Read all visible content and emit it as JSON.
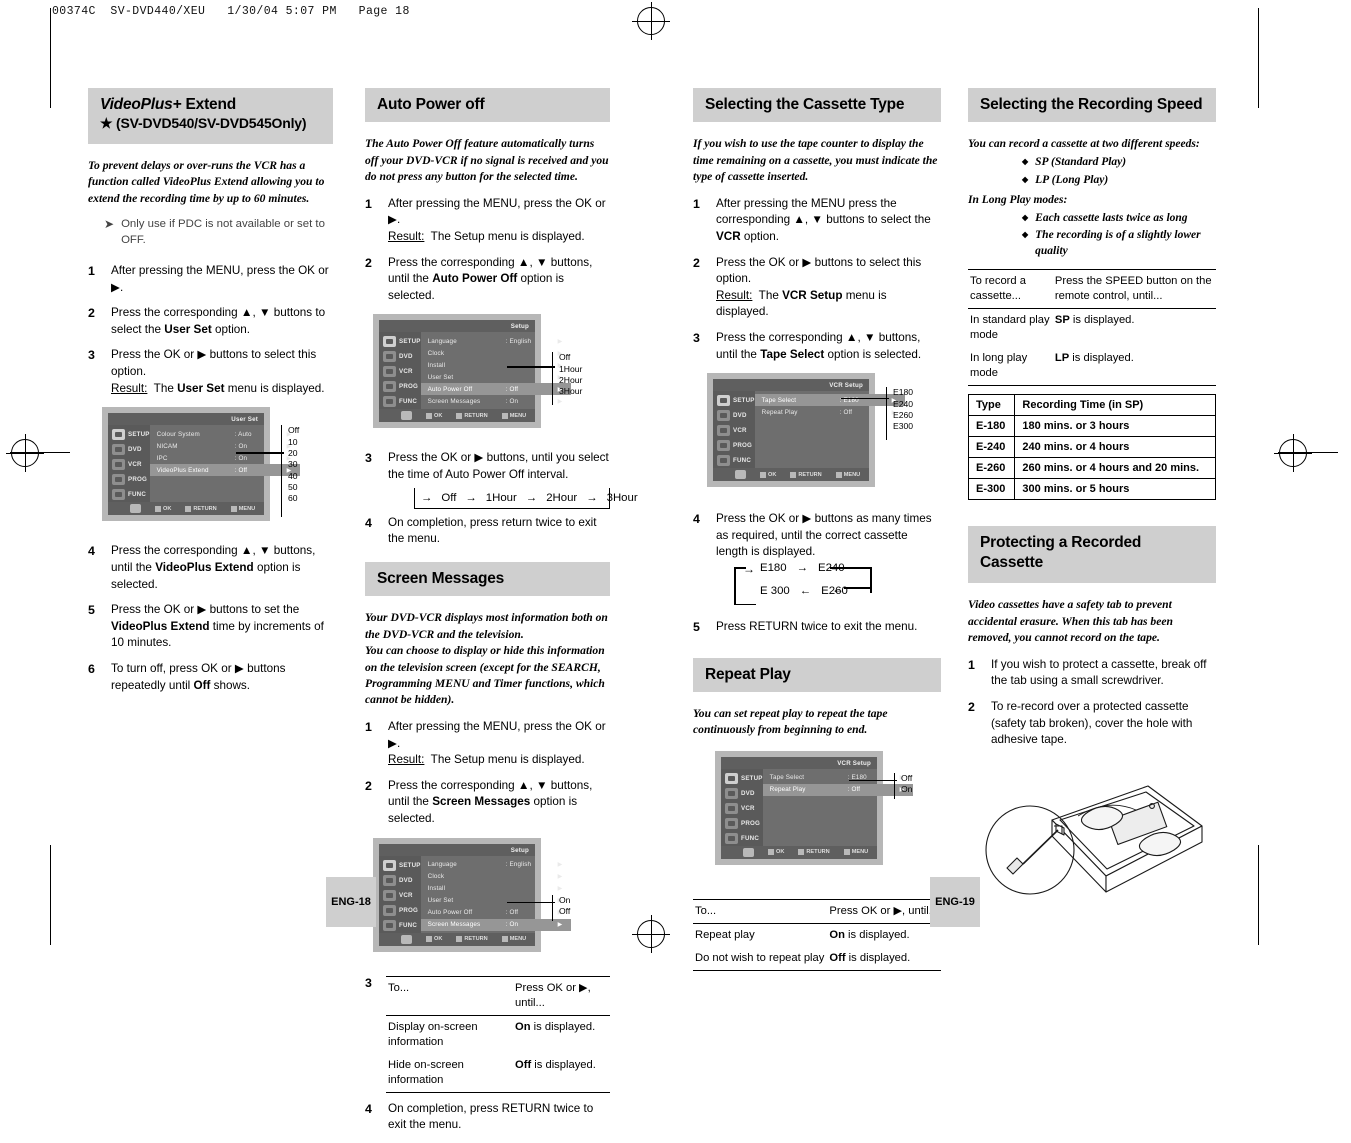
{
  "scan_header": "00374C  SV-DVD440/XEU   1/30/04 5:07 PM   Page 18",
  "page_badges": {
    "left": "ENG-18",
    "right": "ENG-19"
  },
  "osd_footer": {
    "ok": "OK",
    "return": "RETURN",
    "menu": "MENU"
  },
  "osd_sidebar": [
    "SETUP",
    "DVD",
    "VCR",
    "PROG",
    "FUNC"
  ],
  "col1": {
    "heading_line1_em": "VideoPlus+",
    "heading_line1_rest": " Extend",
    "heading_line2": "★ (SV-DVD540/SV-DVD545Only)",
    "intro": "To prevent delays or over-runs the VCR has a function called VideoPlus Extend allowing you to extend the recording time by up to 60 minutes.",
    "note": "Only use if PDC is not available or set to OFF.",
    "steps": [
      {
        "n": "1",
        "html": "After pressing the MENU, press the OK or ▶."
      },
      {
        "n": "2",
        "html": "Press the corresponding ▲, ▼ buttons to select the <b>User Set</b> option."
      },
      {
        "n": "3",
        "html": "Press the OK or ▶ buttons to select this option.<br><span class=\"u\">Result:</span>&nbsp; The <b>User Set</b> menu is displayed."
      }
    ],
    "osd": {
      "title": "User Set",
      "rows": [
        {
          "label": "Colour System",
          "value": ": Auto",
          "hl": false
        },
        {
          "label": "NICAM",
          "value": ": On",
          "hl": false
        },
        {
          "label": "IPC",
          "value": ": On",
          "hl": false
        },
        {
          "label": "VideoPlus Extend",
          "value": ": Off",
          "hl": true
        }
      ],
      "callout": [
        "Off",
        "10",
        "20",
        "30",
        "40",
        "50",
        "60"
      ]
    },
    "steps2": [
      {
        "n": "4",
        "html": "Press the corresponding ▲, ▼ buttons, until the <b>VideoPlus Extend</b> option is selected."
      },
      {
        "n": "5",
        "html": "Press the OK or ▶ buttons to set the <b>VideoPlus Extend</b> time by increments of 10 minutes."
      },
      {
        "n": "6",
        "html": "To turn off, press OK or ▶ buttons repeatedly until <b>Off</b> shows."
      }
    ]
  },
  "col2": {
    "heading1": "Auto Power off",
    "intro1": "The Auto Power Off feature automatically turns off your DVD-VCR if no signal is received and you do not press any button for the selected time.",
    "steps1": [
      {
        "n": "1",
        "html": "After pressing the MENU, press the OK or ▶.<br><span class=\"u\">Result:</span>&nbsp; The Setup menu is displayed."
      },
      {
        "n": "2",
        "html": "Press the corresponding ▲, ▼ buttons, until the <b>Auto Power Off</b> option is selected."
      }
    ],
    "osd1": {
      "title": "Setup",
      "rows": [
        {
          "label": "Language",
          "value": ": English",
          "hl": false
        },
        {
          "label": "Clock",
          "value": "",
          "hl": false
        },
        {
          "label": "Install",
          "value": "",
          "hl": false
        },
        {
          "label": "User Set",
          "value": "",
          "hl": false
        },
        {
          "label": "Auto Power Off",
          "value": ": Off",
          "hl": true
        },
        {
          "label": "Screen Messages",
          "value": ": On",
          "hl": false
        }
      ],
      "callout": [
        "Off",
        "1Hour",
        "2Hour",
        "3Hour"
      ]
    },
    "steps2": [
      {
        "n": "3",
        "html": "Press the OK or ▶ buttons, until you select the time of Auto Power Off interval."
      },
      {
        "n": "4",
        "html": "On completion, press return twice to exit the menu."
      }
    ],
    "cycle": [
      "Off",
      "1Hour",
      "2Hour",
      "3Hour"
    ],
    "heading2": "Screen Messages",
    "intro2": "Your DVD-VCR displays most information both on the DVD-VCR and the television.\nYou can choose to display or hide this information on the television screen (except for the SEARCH, Programming MENU and Timer functions, which cannot be hidden).",
    "steps3": [
      {
        "n": "1",
        "html": "After pressing the MENU, press the OK or ▶.<br><span class=\"u\">Result:</span>&nbsp; The Setup menu is displayed."
      },
      {
        "n": "2",
        "html": "Press the corresponding ▲, ▼ buttons, until the <b>Screen Messages</b> option is selected."
      }
    ],
    "osd2": {
      "title": "Setup",
      "rows": [
        {
          "label": "Language",
          "value": ": English",
          "hl": false
        },
        {
          "label": "Clock",
          "value": "",
          "hl": false
        },
        {
          "label": "Install",
          "value": "",
          "hl": false
        },
        {
          "label": "User Set",
          "value": "",
          "hl": false
        },
        {
          "label": "Auto Power Off",
          "value": ": Off",
          "hl": false
        },
        {
          "label": "Screen Messages",
          "value": ": On",
          "hl": true
        }
      ],
      "callout": [
        "On",
        "Off"
      ]
    },
    "table": {
      "step_n": "3",
      "head": [
        "To...",
        "Press OK or ▶, until..."
      ],
      "rows": [
        [
          "Display on-screen information",
          "On is displayed."
        ],
        [
          "Hide on-screen information",
          "Off is displayed."
        ]
      ]
    },
    "step4": {
      "n": "4",
      "html": "On completion, press RETURN twice to exit the menu."
    }
  },
  "col3": {
    "heading1": "Selecting the Cassette Type",
    "intro1": "If you wish to use the tape counter to display the time remaining on a cassette, you must indicate the type of cassette inserted.",
    "steps1": [
      {
        "n": "1",
        "html": "After pressing the MENU press the corresponding ▲, ▼ buttons to select the <b>VCR</b> option."
      },
      {
        "n": "2",
        "html": "Press the OK or ▶ buttons to select this option.<br><span class=\"u\">Result:</span>&nbsp; The <b>VCR Setup</b> menu is displayed."
      },
      {
        "n": "3",
        "html": "Press the corresponding ▲, ▼ buttons, until the <b>Tape Select</b> option is selected."
      }
    ],
    "osd1": {
      "title": "VCR Setup",
      "rows": [
        {
          "label": "Tape Select",
          "value": ": E180",
          "hl": true
        },
        {
          "label": "Repeat Play",
          "value": ": Off",
          "hl": false
        }
      ],
      "callout": [
        "E180",
        "E240",
        "E260",
        "E300"
      ]
    },
    "steps2": [
      {
        "n": "4",
        "html": "Press the OK or ▶ buttons as many times as required, until the correct cassette length is displayed."
      },
      {
        "n": "5",
        "html": "Press RETURN twice to exit the menu."
      }
    ],
    "cycle_top": [
      "E180",
      "E240"
    ],
    "cycle_bottom": [
      "E 300",
      "E260"
    ],
    "heading2": "Repeat Play",
    "intro2": "You can set repeat play to repeat the tape continuously from beginning to end.",
    "osd2": {
      "title": "VCR Setup",
      "rows": [
        {
          "label": "Tape Select",
          "value": ": E180",
          "hl": false
        },
        {
          "label": "Repeat Play",
          "value": ": Off",
          "hl": true
        }
      ],
      "callout": [
        "Off",
        "On"
      ]
    },
    "table": {
      "head": [
        "To...",
        "Press OK or ▶, until..."
      ],
      "rows": [
        [
          "Repeat play",
          "On is displayed."
        ],
        [
          "Do not wish to repeat play",
          "Off is displayed."
        ]
      ]
    }
  },
  "col4": {
    "heading1": "Selecting the Recording Speed",
    "lead1": "You can record a cassette at two different speeds:",
    "bullets1": [
      "SP (Standard Play)",
      "LP (Long Play)"
    ],
    "lead2": "In Long Play modes:",
    "bullets2": [
      "Each cassette lasts twice as long",
      "The recording is of a slightly lower quality"
    ],
    "table1": {
      "head": [
        "To record a cassette...",
        "Press the SPEED button on the remote control, until..."
      ],
      "rows": [
        [
          "In standard play mode",
          "SP is displayed."
        ],
        [
          "In long play mode",
          "LP is displayed."
        ]
      ]
    },
    "table2": {
      "head": [
        "Type",
        "Recording Time (in SP)"
      ],
      "rows": [
        [
          "E-180",
          "180 mins. or 3 hours"
        ],
        [
          "E-240",
          "240 mins. or 4 hours"
        ],
        [
          "E-260",
          "260 mins. or 4 hours and 20 mins."
        ],
        [
          "E-300",
          "300 mins. or 5 hours"
        ]
      ]
    },
    "heading2": "Protecting a Recorded Cassette",
    "intro2": "Video cassettes have a safety tab to prevent accidental erasure. When this tab has been removed, you cannot record on the tape.",
    "steps": [
      {
        "n": "1",
        "html": "If you wish to protect a cassette, break off the tab using a small screwdriver."
      },
      {
        "n": "2",
        "html": "To re-record over a protected cassette (safety tab broken), cover the hole with adhesive tape."
      }
    ]
  }
}
